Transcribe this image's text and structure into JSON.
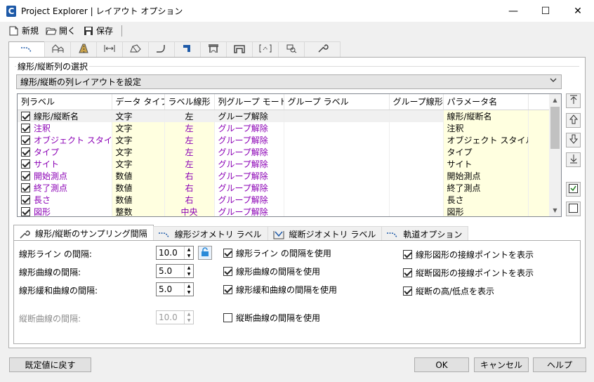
{
  "window": {
    "title": "Project Explorer | レイアウト オプション",
    "minimize": "—",
    "maximize": "☐",
    "close": "✕"
  },
  "toolbar": {
    "new_label": "新規",
    "open_label": "開く",
    "save_label": "保存"
  },
  "section": {
    "title": "線形/縦断列の選択"
  },
  "combo": {
    "value": "線形/縦断の列レイアウトを設定"
  },
  "grid": {
    "headers": [
      "列ラベル",
      "データ タイプ",
      "ラベル線形",
      "列グループ モード",
      "グループ ラベル",
      "グループ線形",
      "パラメータ名",
      ""
    ],
    "rows": [
      {
        "label": "線形/縦断名",
        "type": "文字",
        "align": "左",
        "mode": "グループ解除",
        "glabel": "",
        "gline": "",
        "param": "線形/縦断名",
        "checked": true
      },
      {
        "label": "注釈",
        "type": "文字",
        "align": "左",
        "mode": "グループ解除",
        "glabel": "",
        "gline": "",
        "param": "注釈",
        "checked": true
      },
      {
        "label": "オブジェクト スタイル",
        "type": "文字",
        "align": "左",
        "mode": "グループ解除",
        "glabel": "",
        "gline": "",
        "param": "オブジェクト スタイル",
        "checked": true
      },
      {
        "label": "タイプ",
        "type": "文字",
        "align": "左",
        "mode": "グループ解除",
        "glabel": "",
        "gline": "",
        "param": "タイプ",
        "checked": true
      },
      {
        "label": "サイト",
        "type": "文字",
        "align": "左",
        "mode": "グループ解除",
        "glabel": "",
        "gline": "",
        "param": "サイト",
        "checked": true
      },
      {
        "label": "開始測点",
        "type": "数値",
        "align": "右",
        "mode": "グループ解除",
        "glabel": "",
        "gline": "",
        "param": "開始測点",
        "checked": true
      },
      {
        "label": "終了測点",
        "type": "数値",
        "align": "右",
        "mode": "グループ解除",
        "glabel": "",
        "gline": "",
        "param": "終了測点",
        "checked": true
      },
      {
        "label": "長さ",
        "type": "数値",
        "align": "右",
        "mode": "グループ解除",
        "glabel": "",
        "gline": "",
        "param": "長さ",
        "checked": true
      },
      {
        "label": "図形",
        "type": "整数",
        "align": "中央",
        "mode": "グループ解除",
        "glabel": "",
        "gline": "",
        "param": "図形",
        "checked": true
      }
    ]
  },
  "subtabs": [
    {
      "label": "線形/縦断のサンプリング間隔",
      "icon": "wrench-icon"
    },
    {
      "label": "線形ジオメトリ ラベル",
      "icon": "alignment-icon"
    },
    {
      "label": "縦断ジオメトリ ラベル",
      "icon": "profile-icon"
    },
    {
      "label": "軌道オプション",
      "icon": "rail-icon"
    }
  ],
  "sampling": {
    "line_label": "線形ライン の間隔:",
    "line_value": "10.0",
    "curve_label": "線形曲線の間隔:",
    "curve_value": "5.0",
    "spiral_label": "線形緩和曲線の間隔:",
    "spiral_value": "5.0",
    "vcurve_label": "縦断曲線の間隔:",
    "vcurve_value": "10.0",
    "use_line": "線形ライン の間隔を使用",
    "use_curve": "線形曲線の間隔を使用",
    "use_spiral": "線形緩和曲線の間隔を使用",
    "use_vcurve": "縦断曲線の間隔を使用",
    "show_align_pts": "線形図形の接線ポイントを表示",
    "show_prof_pts": "縦断図形の接線ポイントを表示",
    "show_highlow": "縦断の高/低点を表示"
  },
  "buttons": {
    "reset": "既定値に戻す",
    "ok": "OK",
    "cancel": "キャンセル",
    "help": "ヘルプ"
  },
  "colors": {
    "purple_text": "#8b00b5",
    "editable_cell": "#ffffe0",
    "accent": "#1e5aa8"
  }
}
